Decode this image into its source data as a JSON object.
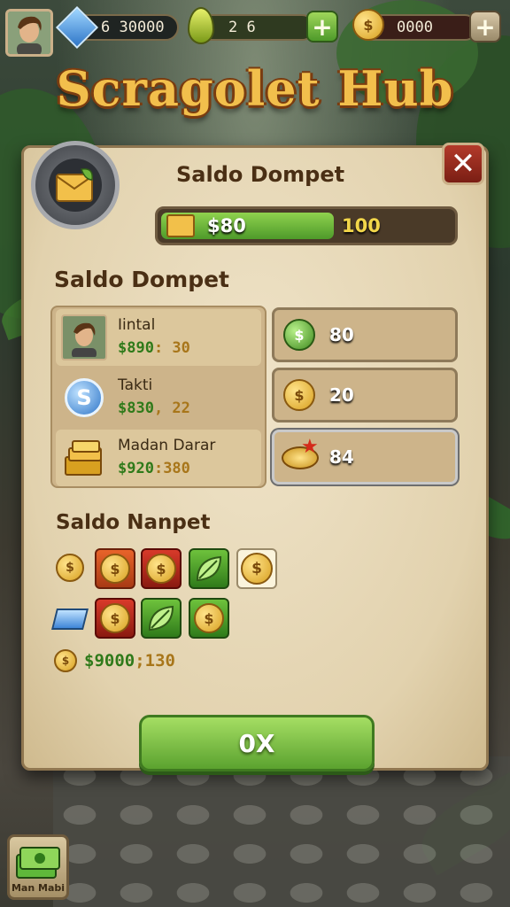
{
  "topbar": {
    "gems": "6 30000",
    "energy": "2 6",
    "gold": "0000",
    "plus_label": "+"
  },
  "hub_title": "Scragolet Hub",
  "panel": {
    "header": "Saldo Dompet",
    "bar_left": "$80",
    "bar_right": "100",
    "bar_fill_fraction": 0.58,
    "section1": "Saldo Dompet",
    "accounts": [
      {
        "name": "Iintal",
        "value_green": "$890",
        "value_sep": ": 30",
        "icon": "portrait-icon"
      },
      {
        "name": "Takti",
        "value_green": "$830",
        "value_sep": ", 22",
        "icon": "s-token-icon"
      },
      {
        "name": "Madan Darar",
        "value_green": "$920",
        "value_sep": ":380",
        "icon": "gold-stack-icon"
      }
    ],
    "balances": [
      {
        "value": "80",
        "icon": "green-coin-icon"
      },
      {
        "value": "20",
        "icon": "gold-coin-icon"
      },
      {
        "value": "84",
        "icon": "gold-pile-icon"
      }
    ],
    "section2": "Saldo Nanpet",
    "tile_symbol": "$",
    "summary_green": "$9000",
    "summary_rest": ";130",
    "ok_label": "0X",
    "close_label": "✕"
  },
  "corner_button": {
    "label": "Man Mabi",
    "icon": "money-bundle-icon"
  },
  "colors": {
    "accent": "#f2bf4c",
    "green": "#5ba22f",
    "red": "#b33a2a"
  }
}
